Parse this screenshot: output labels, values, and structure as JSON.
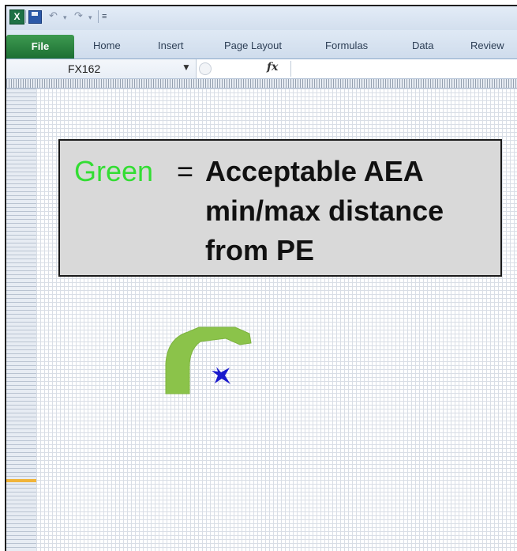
{
  "app": {
    "name_box_value": "FX162",
    "formula_icon": "fx"
  },
  "ribbon": {
    "tabs": [
      "File",
      "Home",
      "Insert",
      "Page Layout",
      "Formulas",
      "Data",
      "Review"
    ]
  },
  "callout": {
    "keyword": "Green",
    "equals": "=",
    "line1": "Acceptable AEA",
    "line2": "min/max distance",
    "line3": "from PE"
  },
  "colors": {
    "keyword": "#33dd33",
    "arc": "#8bc34a",
    "marker": "#1a1acc",
    "file_tab": "#2a7f3f"
  },
  "icons": {
    "app": "excel-icon",
    "save": "save-icon",
    "undo": "undo-icon",
    "redo": "redo-icon",
    "customize": "customize-qat-icon",
    "namebox_dropdown": "chevron-down-icon",
    "cancel": "cancel-icon",
    "function": "function-icon",
    "marker": "star-marker-icon"
  }
}
